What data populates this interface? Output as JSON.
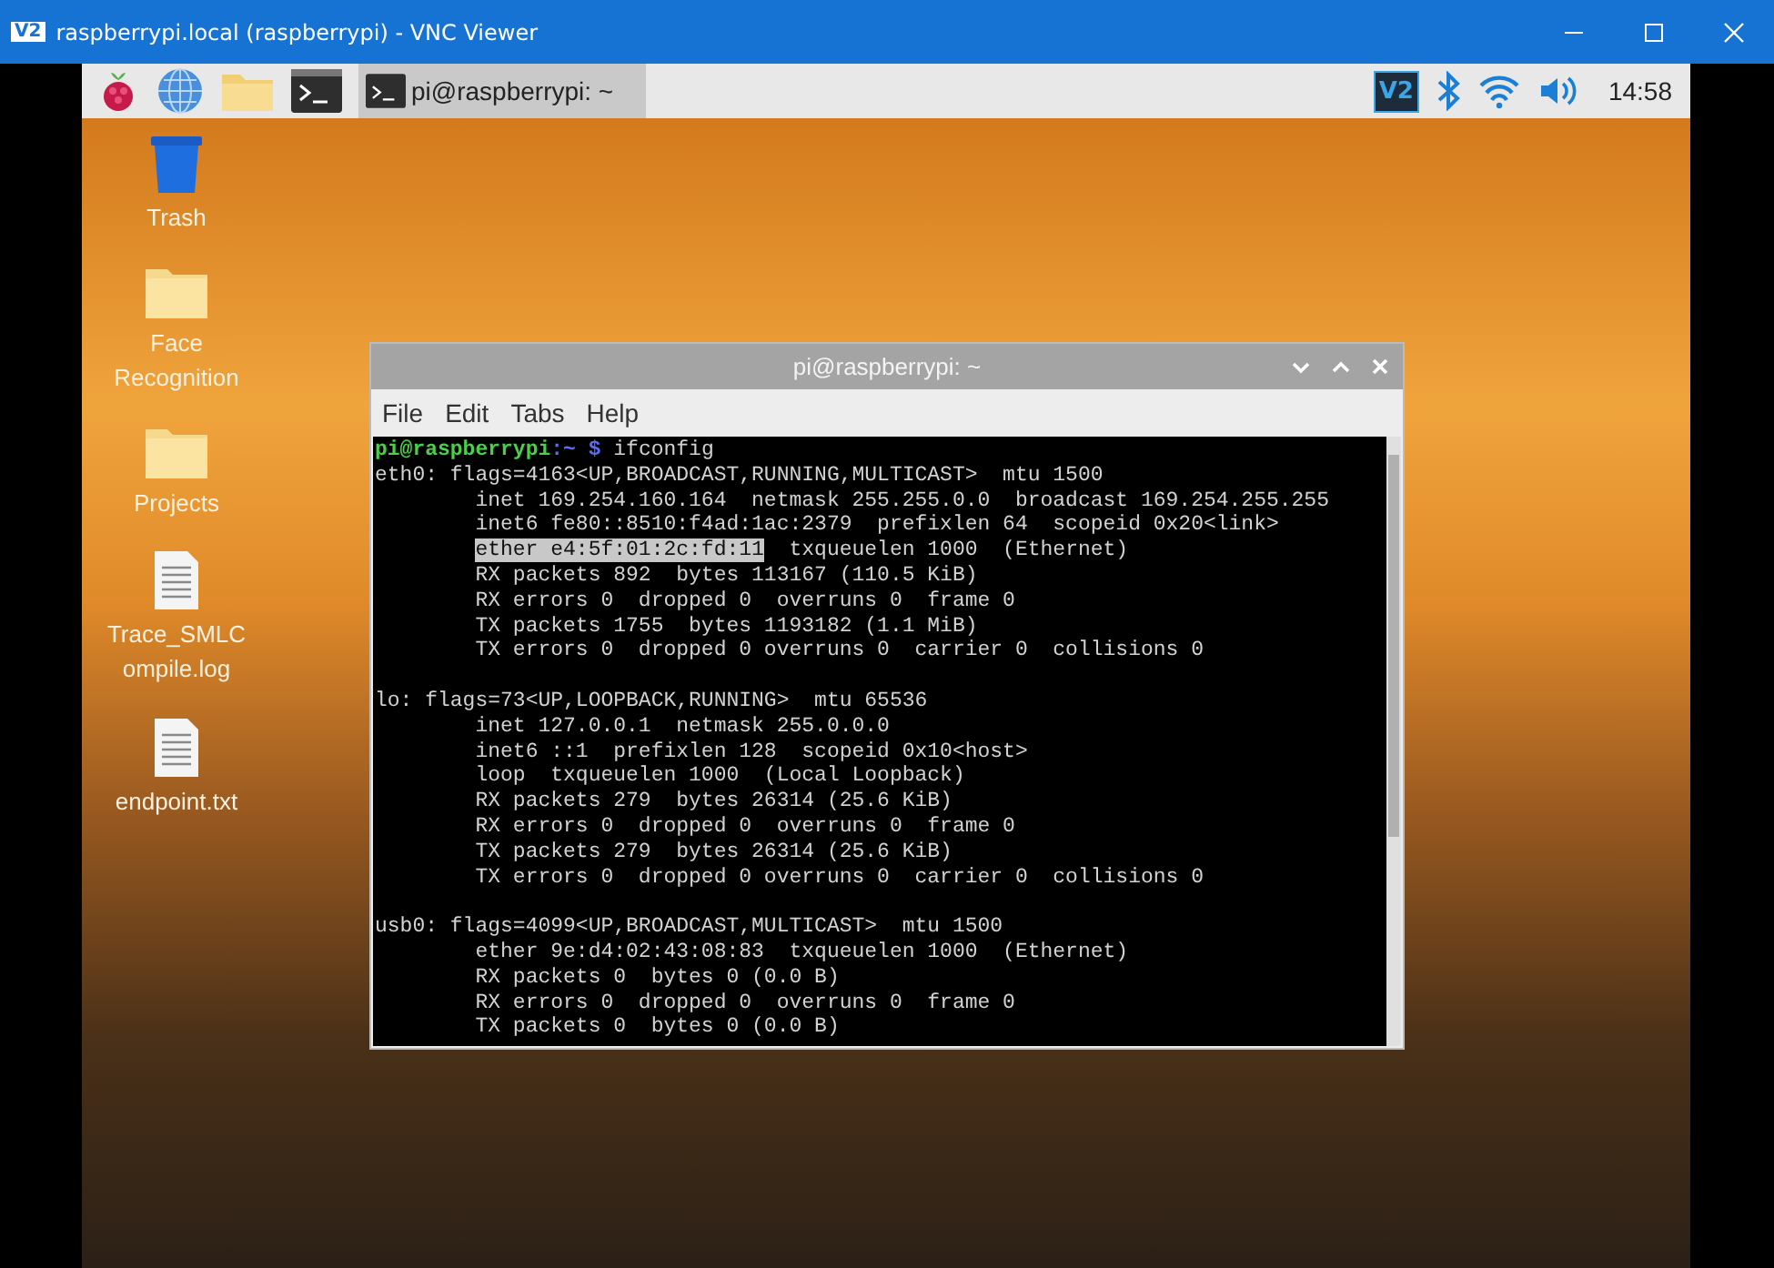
{
  "window": {
    "title": "raspberrypi.local (raspberrypi) - VNC Viewer",
    "logo": "V2"
  },
  "taskbar": {
    "task": {
      "label": "pi@raspberrypi: ~",
      "selected": true
    },
    "tray_logo": "V2",
    "clock": "14:58"
  },
  "desktop_icons": [
    {
      "kind": "trash",
      "label": "Trash"
    },
    {
      "kind": "folder",
      "label": "Face Recognition"
    },
    {
      "kind": "folder",
      "label": "Projects"
    },
    {
      "kind": "file",
      "label": "Trace_SMLCompile.log"
    },
    {
      "kind": "file",
      "label": "endpoint.txt"
    }
  ],
  "terminal": {
    "title": "pi@raspberrypi: ~",
    "menu": [
      "File",
      "Edit",
      "Tabs",
      "Help"
    ],
    "lines": [
      {
        "kind": "prompt",
        "user": "pi@raspberrypi",
        "path": ":~",
        "symbol": "$",
        "command": "ifconfig"
      },
      {
        "kind": "plain",
        "text": "eth0: flags=4163<UP,BROADCAST,RUNNING,MULTICAST>  mtu 1500"
      },
      {
        "kind": "plain",
        "text": "        inet 169.254.160.164  netmask 255.255.0.0  broadcast 169.254.255.255"
      },
      {
        "kind": "plain",
        "text": "        inet6 fe80::8510:f4ad:1ac:2379  prefixlen 64  scopeid 0x20<link>"
      },
      {
        "kind": "selection",
        "selected_text": "ether e4:5f:01:2c:fd:11",
        "text": "  txqueuelen 1000  (Ethernet)"
      },
      {
        "kind": "plain",
        "text": "        RX packets 892  bytes 113167 (110.5 KiB)"
      },
      {
        "kind": "plain",
        "text": "        RX errors 0  dropped 0  overruns 0  frame 0"
      },
      {
        "kind": "plain",
        "text": "        TX packets 1755  bytes 1193182 (1.1 MiB)"
      },
      {
        "kind": "plain",
        "text": "        TX errors 0  dropped 0 overruns 0  carrier 0  collisions 0"
      },
      {
        "kind": "blank"
      },
      {
        "kind": "plain",
        "text": "lo: flags=73<UP,LOOPBACK,RUNNING>  mtu 65536"
      },
      {
        "kind": "plain",
        "text": "        inet 127.0.0.1  netmask 255.0.0.0"
      },
      {
        "kind": "plain",
        "text": "        inet6 ::1  prefixlen 128  scopeid 0x10<host>"
      },
      {
        "kind": "plain",
        "text": "        loop  txqueuelen 1000  (Local Loopback)"
      },
      {
        "kind": "plain",
        "text": "        RX packets 279  bytes 26314 (25.6 KiB)"
      },
      {
        "kind": "plain",
        "text": "        RX errors 0  dropped 0  overruns 0  frame 0"
      },
      {
        "kind": "plain",
        "text": "        TX packets 279  bytes 26314 (25.6 KiB)"
      },
      {
        "kind": "plain",
        "text": "        TX errors 0  dropped 0 overruns 0  carrier 0  collisions 0"
      },
      {
        "kind": "blank"
      },
      {
        "kind": "plain",
        "text": "usb0: flags=4099<UP,BROADCAST,MULTICAST>  mtu 1500"
      },
      {
        "kind": "plain",
        "text": "        ether 9e:d4:02:43:08:83  txqueuelen 1000  (Ethernet)"
      },
      {
        "kind": "plain",
        "text": "        RX packets 0  bytes 0 (0.0 B)"
      },
      {
        "kind": "plain",
        "text": "        RX errors 0  dropped 0  overruns 0  frame 0"
      },
      {
        "kind": "plain",
        "text": "        TX packets 0  bytes 0 (0.0 B)"
      }
    ]
  }
}
